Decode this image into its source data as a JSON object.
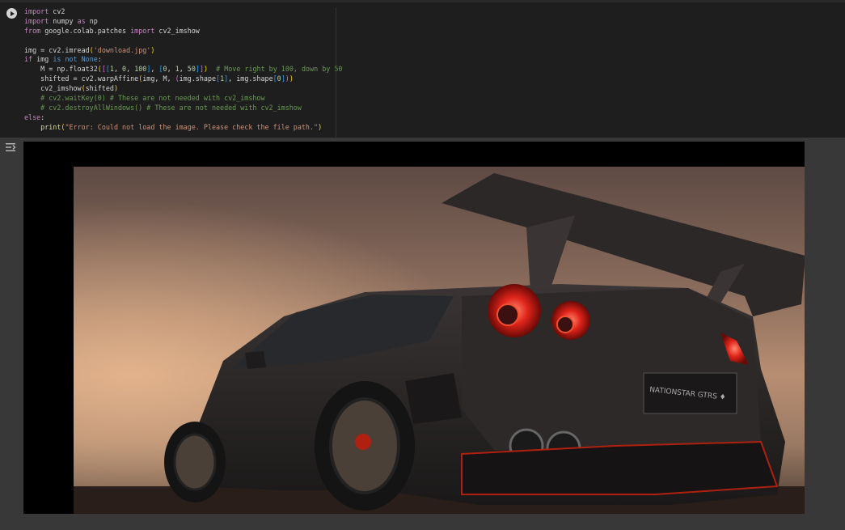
{
  "cell": {
    "run_button": "run-cell",
    "code_lines": [
      [
        [
          "kw",
          "import"
        ],
        [
          "p",
          " cv2"
        ]
      ],
      [
        [
          "kw",
          "import"
        ],
        [
          "p",
          " numpy "
        ],
        [
          "kw",
          "as"
        ],
        [
          "p",
          " np"
        ]
      ],
      [
        [
          "kw",
          "from"
        ],
        [
          "p",
          " google.colab.patches "
        ],
        [
          "kw",
          "import"
        ],
        [
          "p",
          " cv2_imshow"
        ]
      ],
      [],
      [
        [
          "p",
          "img = cv2.imread"
        ],
        [
          "br1",
          "("
        ],
        [
          "str",
          "'download.jpg'"
        ],
        [
          "br1",
          ")"
        ]
      ],
      [
        [
          "kw",
          "if"
        ],
        [
          "p",
          " img "
        ],
        [
          "kw2",
          "is not"
        ],
        [
          "p",
          " "
        ],
        [
          "kw2",
          "None"
        ],
        [
          "p",
          ":"
        ]
      ],
      [
        [
          "p",
          "    M = np.float32"
        ],
        [
          "br1",
          "("
        ],
        [
          "br2",
          "["
        ],
        [
          "br3",
          "["
        ],
        [
          "num",
          "1"
        ],
        [
          "p",
          ", "
        ],
        [
          "num",
          "0"
        ],
        [
          "p",
          ", "
        ],
        [
          "num",
          "100"
        ],
        [
          "br3",
          "]"
        ],
        [
          "p",
          ", "
        ],
        [
          "br3",
          "["
        ],
        [
          "num",
          "0"
        ],
        [
          "p",
          ", "
        ],
        [
          "num",
          "1"
        ],
        [
          "p",
          ", "
        ],
        [
          "num",
          "50"
        ],
        [
          "br3",
          "]"
        ],
        [
          "br2",
          "]"
        ],
        [
          "br1",
          ")"
        ],
        [
          "p",
          "  "
        ],
        [
          "cm",
          "# Move right by 100, down by 50"
        ]
      ],
      [
        [
          "p",
          "    shifted = cv2.warpAffine"
        ],
        [
          "br1",
          "("
        ],
        [
          "p",
          "img, M, "
        ],
        [
          "br2",
          "("
        ],
        [
          "p",
          "img.shape"
        ],
        [
          "br3",
          "["
        ],
        [
          "num",
          "1"
        ],
        [
          "br3",
          "]"
        ],
        [
          "p",
          ", img.shape"
        ],
        [
          "br3",
          "["
        ],
        [
          "num",
          "0"
        ],
        [
          "br3",
          "]"
        ],
        [
          "br2",
          ")"
        ],
        [
          "br1",
          ")"
        ]
      ],
      [
        [
          "p",
          "    cv2_imshow"
        ],
        [
          "br1",
          "("
        ],
        [
          "p",
          "shifted"
        ],
        [
          "br1",
          ")"
        ]
      ],
      [
        [
          "cm",
          "    # cv2.waitKey(0) # These are not needed with cv2_imshow"
        ]
      ],
      [
        [
          "cm",
          "    # cv2.destroyAllWindows() # These are not needed with cv2_imshow"
        ]
      ],
      [
        [
          "kw",
          "else"
        ],
        [
          "p",
          ":"
        ]
      ],
      [
        [
          "p",
          "    "
        ],
        [
          "fn",
          "print"
        ],
        [
          "br1",
          "("
        ],
        [
          "str",
          "\"Error: Could not load the image. Please check the file path.\""
        ],
        [
          "br1",
          ")"
        ]
      ]
    ]
  },
  "output": {
    "icon": "output-toggle-icon",
    "image_description_icon": "shifted-car-image"
  }
}
